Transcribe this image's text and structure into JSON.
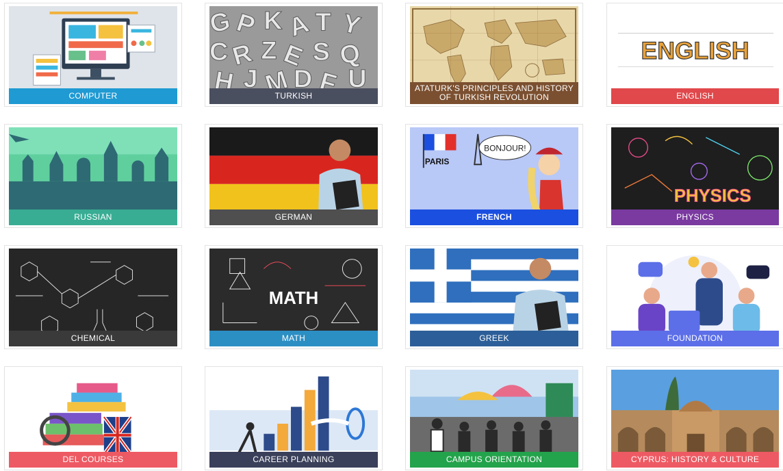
{
  "courses": [
    {
      "label": "COMPUTER",
      "color": "#1f9ad3"
    },
    {
      "label": "TURKISH",
      "color": "#4a4f5f"
    },
    {
      "label": "ATATURK'S PRINCIPLES AND HISTORY OF TURKISH REVOLUTION",
      "color": "#7b5030"
    },
    {
      "label": "ENGLISH",
      "color": "#e0484b"
    },
    {
      "label": "RUSSIAN",
      "color": "#38ad94"
    },
    {
      "label": "GERMAN",
      "color": "#4f4f4f"
    },
    {
      "label": "FRENCH",
      "color": "#1b4fe0"
    },
    {
      "label": "PHYSICS",
      "color": "#7a3aa0"
    },
    {
      "label": "CHEMICAL",
      "color": "#3a3a3a"
    },
    {
      "label": "MATH",
      "color": "#2c8fc4"
    },
    {
      "label": "GREEK",
      "color": "#2c5f99"
    },
    {
      "label": "FOUNDATION",
      "color": "#5c6fe8"
    },
    {
      "label": "DEL COURSES",
      "color": "#ee5a63"
    },
    {
      "label": "CAREER PLANNING",
      "color": "#3a3f5a"
    },
    {
      "label": "CAMPUS ORIENTATION",
      "color": "#23a34b"
    },
    {
      "label": "CYPRUS: HISTORY & CULTURE",
      "color": "#ee5a63"
    }
  ],
  "art_text": {
    "english": "ENGLISH",
    "paris": "PARIS",
    "bonjour": "BONJOUR!",
    "physics": "PHYSICS",
    "math": "MATH"
  }
}
